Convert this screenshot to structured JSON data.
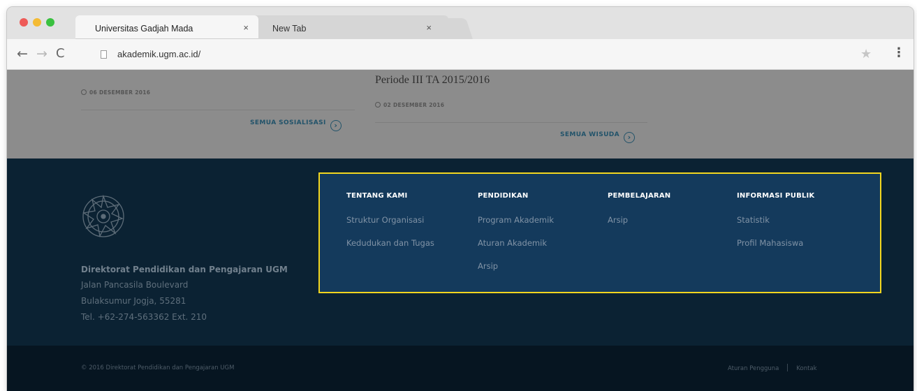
{
  "browser": {
    "tabs": [
      {
        "title": "Universitas Gadjah Mada",
        "close": "×"
      },
      {
        "title": "New Tab",
        "close": "×"
      }
    ],
    "url": "akademik.ugm.ac.id/",
    "icons": {
      "back": "←",
      "forward": "→",
      "reload": "C",
      "star": "★",
      "menu": "⋮"
    }
  },
  "content": {
    "posts": [
      {
        "date": "06 DESEMBER 2016",
        "more_label": "SEMUA SOSIALISASI"
      },
      {
        "title": "Periode III TA 2015/2016",
        "date": "02 DESEMBER 2016",
        "more_label": "SEMUA WISUDA"
      }
    ]
  },
  "footer": {
    "org_name": "Direktorat Pendidikan dan Pengajaran UGM",
    "address": [
      "Jalan Pancasila Boulevard",
      "Bulaksumur Jogja, 55281",
      "Tel. +62-274-563362 Ext. 210"
    ],
    "columns": [
      {
        "heading": "TENTANG KAMI",
        "links": [
          "Struktur Organisasi",
          "Kedudukan dan Tugas"
        ]
      },
      {
        "heading": "PENDIDIKAN",
        "links": [
          "Program Akademik",
          "Aturan Akademik",
          "Arsip"
        ]
      },
      {
        "heading": "PEMBELAJARAN",
        "links": [
          "Arsip"
        ]
      },
      {
        "heading": "INFORMASI PUBLIK",
        "links": [
          "Statistik",
          "Profil Mahasiswa"
        ]
      }
    ],
    "copyright": "© 2016 Direktorat Pendidikan dan Pengajaran UGM",
    "bottom_links": [
      "Aturan Pengguna",
      "Kontak"
    ],
    "highlight_color": "#f3d61f",
    "footer_color": "#0b2233",
    "highlight_bg": "#143a5c"
  }
}
